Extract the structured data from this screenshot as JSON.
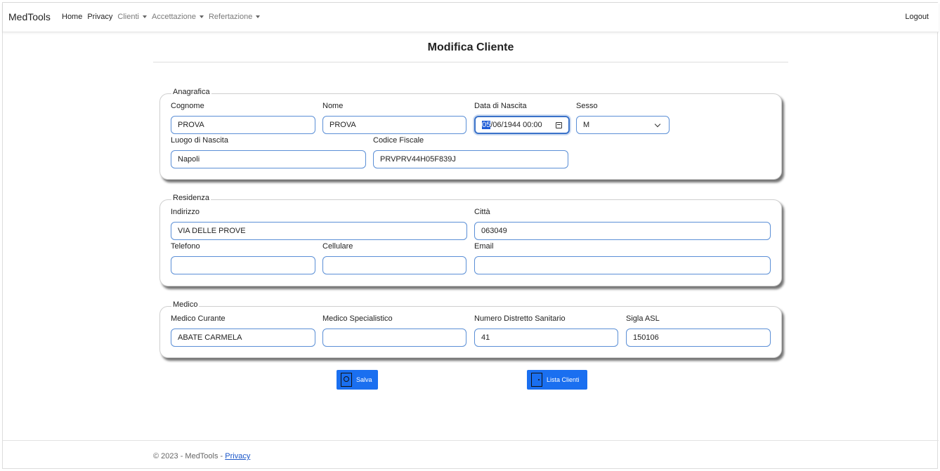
{
  "navbar": {
    "brand": "MedTools",
    "items": [
      {
        "label": "Home"
      },
      {
        "label": "Privacy"
      },
      {
        "label": "Clienti"
      },
      {
        "label": "Accettazione"
      },
      {
        "label": "Refertazione"
      }
    ],
    "logout": "Logout"
  },
  "page": {
    "title": "Modifica Cliente"
  },
  "anagrafica": {
    "legend": "Anagrafica",
    "cognome_label": "Cognome",
    "cognome": "PROVA",
    "nome_label": "Nome",
    "nome": "PROVA",
    "data_label": "Data di Nascita",
    "data_selected": "05",
    "data_rest": "/06/1944 00:00",
    "sesso_label": "Sesso",
    "sesso": "M",
    "luogo_label": "Luogo di Nascita",
    "luogo": "Napoli",
    "cf_label": "Codice Fiscale",
    "cf": "PRVPRV44H05F839J"
  },
  "residenza": {
    "legend": "Residenza",
    "indirizzo_label": "Indirizzo",
    "indirizzo": "VIA DELLE PROVE",
    "citta_label": "Città",
    "citta": "063049",
    "telefono_label": "Telefono",
    "telefono": "",
    "cellulare_label": "Cellulare",
    "cellulare": "",
    "email_label": "Email",
    "email": ""
  },
  "medico": {
    "legend": "Medico",
    "curante_label": "Medico Curante",
    "curante": "ABATE CARMELA",
    "specialistico_label": "Medico Specialistico",
    "specialistico": "",
    "distretto_label": "Numero Distretto Sanitario",
    "distretto": "41",
    "asl_label": "Sigla ASL",
    "asl": "150106"
  },
  "actions": {
    "save": "Salva",
    "list": "Lista Clienti"
  },
  "footer": {
    "text": "© 2023 - MedTools - ",
    "link": "Privacy"
  },
  "colors": {
    "primary": "#1a6ff0",
    "input_border": "#5b8fd6"
  }
}
